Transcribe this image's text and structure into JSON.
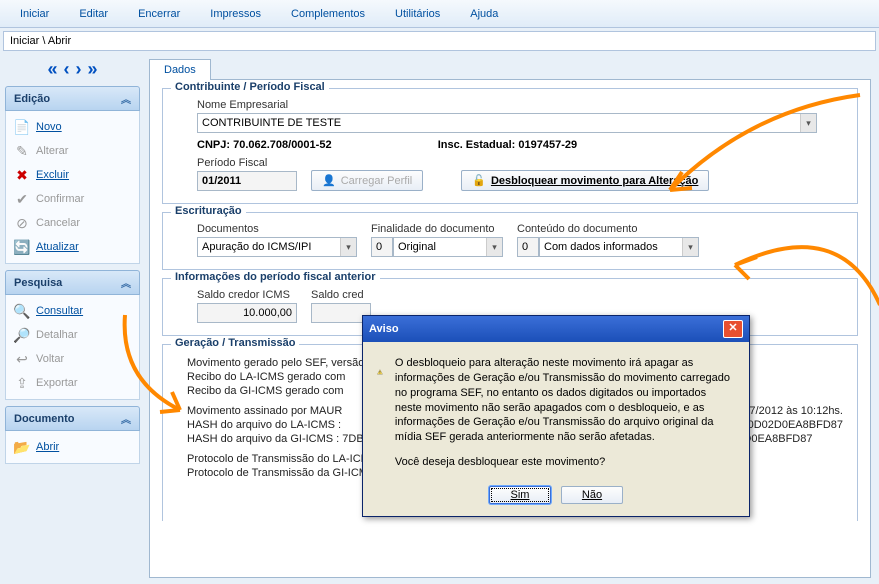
{
  "menu": {
    "items": [
      "Iniciar",
      "Editar",
      "Encerrar",
      "Impressos",
      "Complementos",
      "Utilitários",
      "Ajuda"
    ]
  },
  "breadcrumb": "Iniciar \\ Abrir",
  "sidebar": {
    "edicao": {
      "title": "Edição",
      "items": [
        {
          "label": "Novo",
          "icon": "📄",
          "enabled": true
        },
        {
          "label": "Alterar",
          "icon": "✎",
          "enabled": false
        },
        {
          "label": "Excluir",
          "icon": "✖",
          "enabled": true
        },
        {
          "label": "Confirmar",
          "icon": "✔",
          "enabled": false
        },
        {
          "label": "Cancelar",
          "icon": "⊘",
          "enabled": false
        },
        {
          "label": "Atualizar",
          "icon": "🔄",
          "enabled": true
        }
      ]
    },
    "pesquisa": {
      "title": "Pesquisa",
      "items": [
        {
          "label": "Consultar",
          "icon": "🔍",
          "enabled": true
        },
        {
          "label": "Detalhar",
          "icon": "🔎",
          "enabled": false
        },
        {
          "label": "Voltar",
          "icon": "↩",
          "enabled": false
        },
        {
          "label": "Exportar",
          "icon": "⇪",
          "enabled": false
        }
      ]
    },
    "documento": {
      "title": "Documento",
      "items": [
        {
          "label": "Abrir",
          "icon": "📂",
          "enabled": true
        }
      ]
    }
  },
  "tab": "Dados",
  "contribuinte": {
    "legend": "Contribuinte / Período Fiscal",
    "nome_label": "Nome Empresarial",
    "nome": "CONTRIBUINTE DE TESTE",
    "cnpj_label": "CNPJ:",
    "cnpj": "70.062.708/0001-52",
    "insc_label": "Insc. Estadual:",
    "insc": "0197457-29",
    "periodo_label": "Período Fiscal",
    "periodo": "01/2011",
    "carregar_btn": "Carregar Perfil",
    "desbloquear_btn": "Desbloquear movimento para Alteração"
  },
  "escrituracao": {
    "legend": "Escrituração",
    "doc_label": "Documentos",
    "doc": "Apuração do ICMS/IPI",
    "fin_label": "Finalidade do documento",
    "fin_code": "0",
    "fin_text": "Original",
    "conteudo_label": "Conteúdo do documento",
    "conteudo_code": "0",
    "conteudo_text": "Com dados informados"
  },
  "anterior": {
    "legend": "Informações do período fiscal anterior",
    "saldo_label": "Saldo credor ICMS",
    "saldo": "10.000,00",
    "saldo2_label": "Saldo cred"
  },
  "geracao": {
    "legend": "Geração / Transmissão",
    "lines": [
      "Movimento gerado pelo SEF, versão ...                                                                                                         dação 40.",
      "Recibo do LA-ICMS gerado com",
      "Recibo da GI-ICMS gerado com",
      "Movimento assinado por MAUR",
      "HASH do arquivo do LA-ICMS :",
      "HASH do arquivo da GI-ICMS : 7DBA45A7B3FEF684D7876F54CE9DAECA3049418C, Série do certificado: 0D02D0EA8BFD87",
      "",
      "Protocolo de Transmissão do LA-ICMS : 20120711_000008_0001, transmitido em: 11/07/2012 às 10:13hs.",
      "Protocolo de Transmissão da GI-ICMS : 20120711_000008_0002, transmitido em: 11/07/2012 às 10:13hs."
    ],
    "line_suffix_a": "07/2012 às 10:12hs.",
    "line_suffix_b": ": 0D02D0EA8BFD87"
  },
  "dialog": {
    "title": "Aviso",
    "body": "O desbloqueio para alteração neste movimento irá apagar as informações de Geração e/ou Transmissão do movimento carregado no programa SEF, no entanto os dados digitados ou importados neste movimento não serão apagados com o desbloqueio, e as informações de Geração e/ou Transmissão do arquivo original da mídia SEF gerada anteriormente não serão afetadas.",
    "question": "Você deseja desbloquear este movimento?",
    "yes": "Sim",
    "no": "Não"
  }
}
